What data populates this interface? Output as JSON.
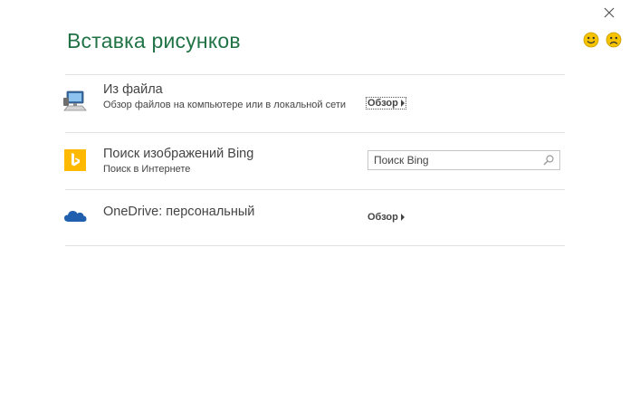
{
  "dialog": {
    "title": "Вставка рисунков"
  },
  "colors": {
    "title": "#217346",
    "smiley_yellow": "#f6c300",
    "bing_yellow": "#ffb900",
    "onedrive_blue": "#1f5fae"
  },
  "sources": [
    {
      "icon": "computer-icon",
      "title": "Из файла",
      "subtitle": "Обзор файлов на компьютере или в локальной сети",
      "action": "Обзор"
    },
    {
      "icon": "bing-icon",
      "title": "Поиск изображений Bing",
      "subtitle": "Поиск в Интернете",
      "search_placeholder": "Поиск Bing"
    },
    {
      "icon": "onedrive-icon",
      "title": "OneDrive: персональный",
      "action": "Обзор"
    }
  ]
}
